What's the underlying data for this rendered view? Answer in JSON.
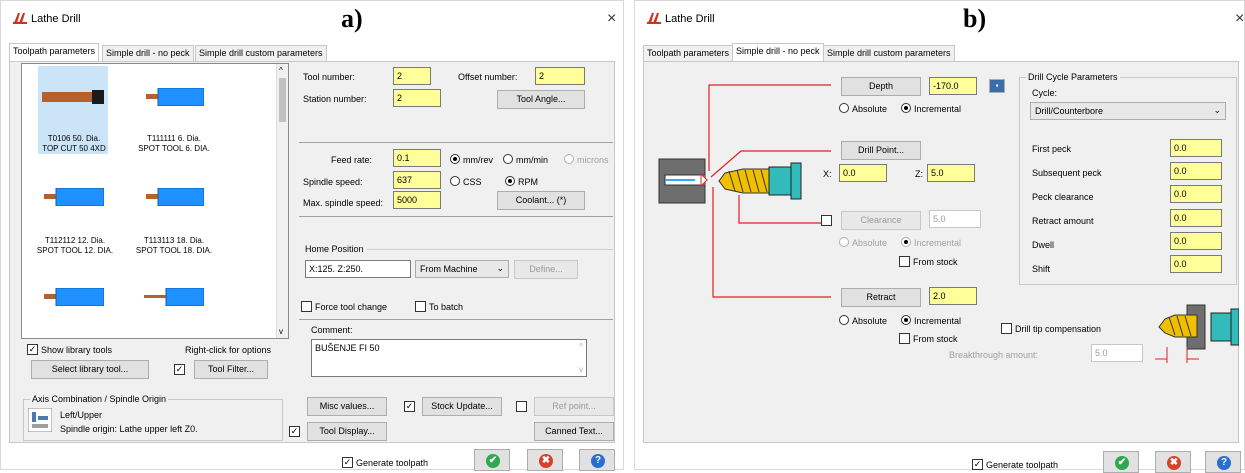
{
  "panel_a": {
    "letter": "a)",
    "title": "Lathe Drill",
    "close": "×",
    "tabs": [
      "Toolpath parameters",
      "Simple drill - no peck",
      "Simple drill custom parameters"
    ],
    "tools": [
      {
        "caption1": "T0106 50. Dia.",
        "caption2": "TOP CUT 50 4XD"
      },
      {
        "caption1": "T111111 6. Dia.",
        "caption2": "SPOT TOOL 6. DIA."
      },
      {
        "caption1": "T112112 12. Dia.",
        "caption2": "SPOT TOOL 12. DIA."
      },
      {
        "caption1": "T113113 18. Dia.",
        "caption2": "SPOT TOOL 18. DIA."
      }
    ],
    "tool_number_label": "Tool number:",
    "tool_number": "2",
    "offset_number_label": "Offset number:",
    "offset_number": "2",
    "station_number_label": "Station number:",
    "station_number": "2",
    "tool_angle": "Tool Angle...",
    "feed_rate_label": "Feed rate:",
    "feed_rate": "0.1",
    "mm_rev": "mm/rev",
    "mm_min": "mm/min",
    "microns": "microns",
    "spindle_speed_label": "Spindle speed:",
    "spindle_speed": "637",
    "css": "CSS",
    "rpm": "RPM",
    "max_spindle_label": "Max. spindle speed:",
    "max_spindle": "5000",
    "coolant": "Coolant... (*)",
    "home_position_label": "Home Position",
    "home_position_value": "X:125.  Z:250.",
    "from_machine": "From Machine",
    "define": "Define...",
    "force_tool_change": "Force tool change",
    "to_batch": "To batch",
    "comment_label": "Comment:",
    "comment": "BUŠENJE FI 50",
    "show_library_tools": "Show library tools",
    "right_click": "Right-click for options",
    "select_library_tool": "Select library tool...",
    "tool_filter": "Tool Filter...",
    "axis_combination_label": "Axis Combination / Spindle Origin",
    "axis_left_upper": "Left/Upper",
    "spindle_origin": "Spindle origin: Lathe upper left  Z0.",
    "misc_values": "Misc values...",
    "stock_update": "Stock Update...",
    "ref_point": "Ref point...",
    "tool_display": "Tool Display...",
    "canned_text": "Canned Text...",
    "generate_toolpath": "Generate toolpath",
    "footer_ok": "✔",
    "footer_cancel": "✖",
    "footer_help": "?"
  },
  "panel_b": {
    "letter": "b)",
    "title": "Lathe Drill",
    "close": "×",
    "tabs": [
      "Toolpath parameters",
      "Simple drill - no peck",
      "Simple drill custom parameters"
    ],
    "depth_btn": "Depth",
    "depth": "-170.0",
    "absolute": "Absolute",
    "incremental": "Incremental",
    "drill_point_btn": "Drill Point...",
    "x_label": "X:",
    "x_value": "0.0",
    "z_label": "Z:",
    "z_value": "5.0",
    "clearance_btn": "Clearance",
    "clearance": "5.0",
    "from_stock": "From stock",
    "retract_btn": "Retract",
    "retract": "2.0",
    "drill_tip_comp": "Drill tip compensation",
    "breakthrough_label": "Breakthrough amount:",
    "breakthrough": "5.0",
    "cycle_params_label": "Drill Cycle Parameters",
    "cycle_label": "Cycle:",
    "cycle_value": "Drill/Counterbore",
    "params": [
      {
        "label": "First peck",
        "value": "0.0"
      },
      {
        "label": "Subsequent peck",
        "value": "0.0"
      },
      {
        "label": "Peck clearance",
        "value": "0.0"
      },
      {
        "label": "Retract amount",
        "value": "0.0"
      },
      {
        "label": "Dwell",
        "value": "0.0"
      },
      {
        "label": "Shift",
        "value": "0.0"
      }
    ],
    "generate_toolpath": "Generate toolpath",
    "footer_ok": "✔",
    "footer_cancel": "✖",
    "footer_help": "?"
  },
  "colors": {
    "yellow_field": "#ffff99",
    "tool_body": "#1e90ff",
    "tool_brown": "#b8602a",
    "selected_tile": "#cce4f7",
    "ok_green": "#2fa84f",
    "cancel_red": "#d8402a",
    "help_blue": "#2a6fd0",
    "diagram_red": "#e02020"
  }
}
